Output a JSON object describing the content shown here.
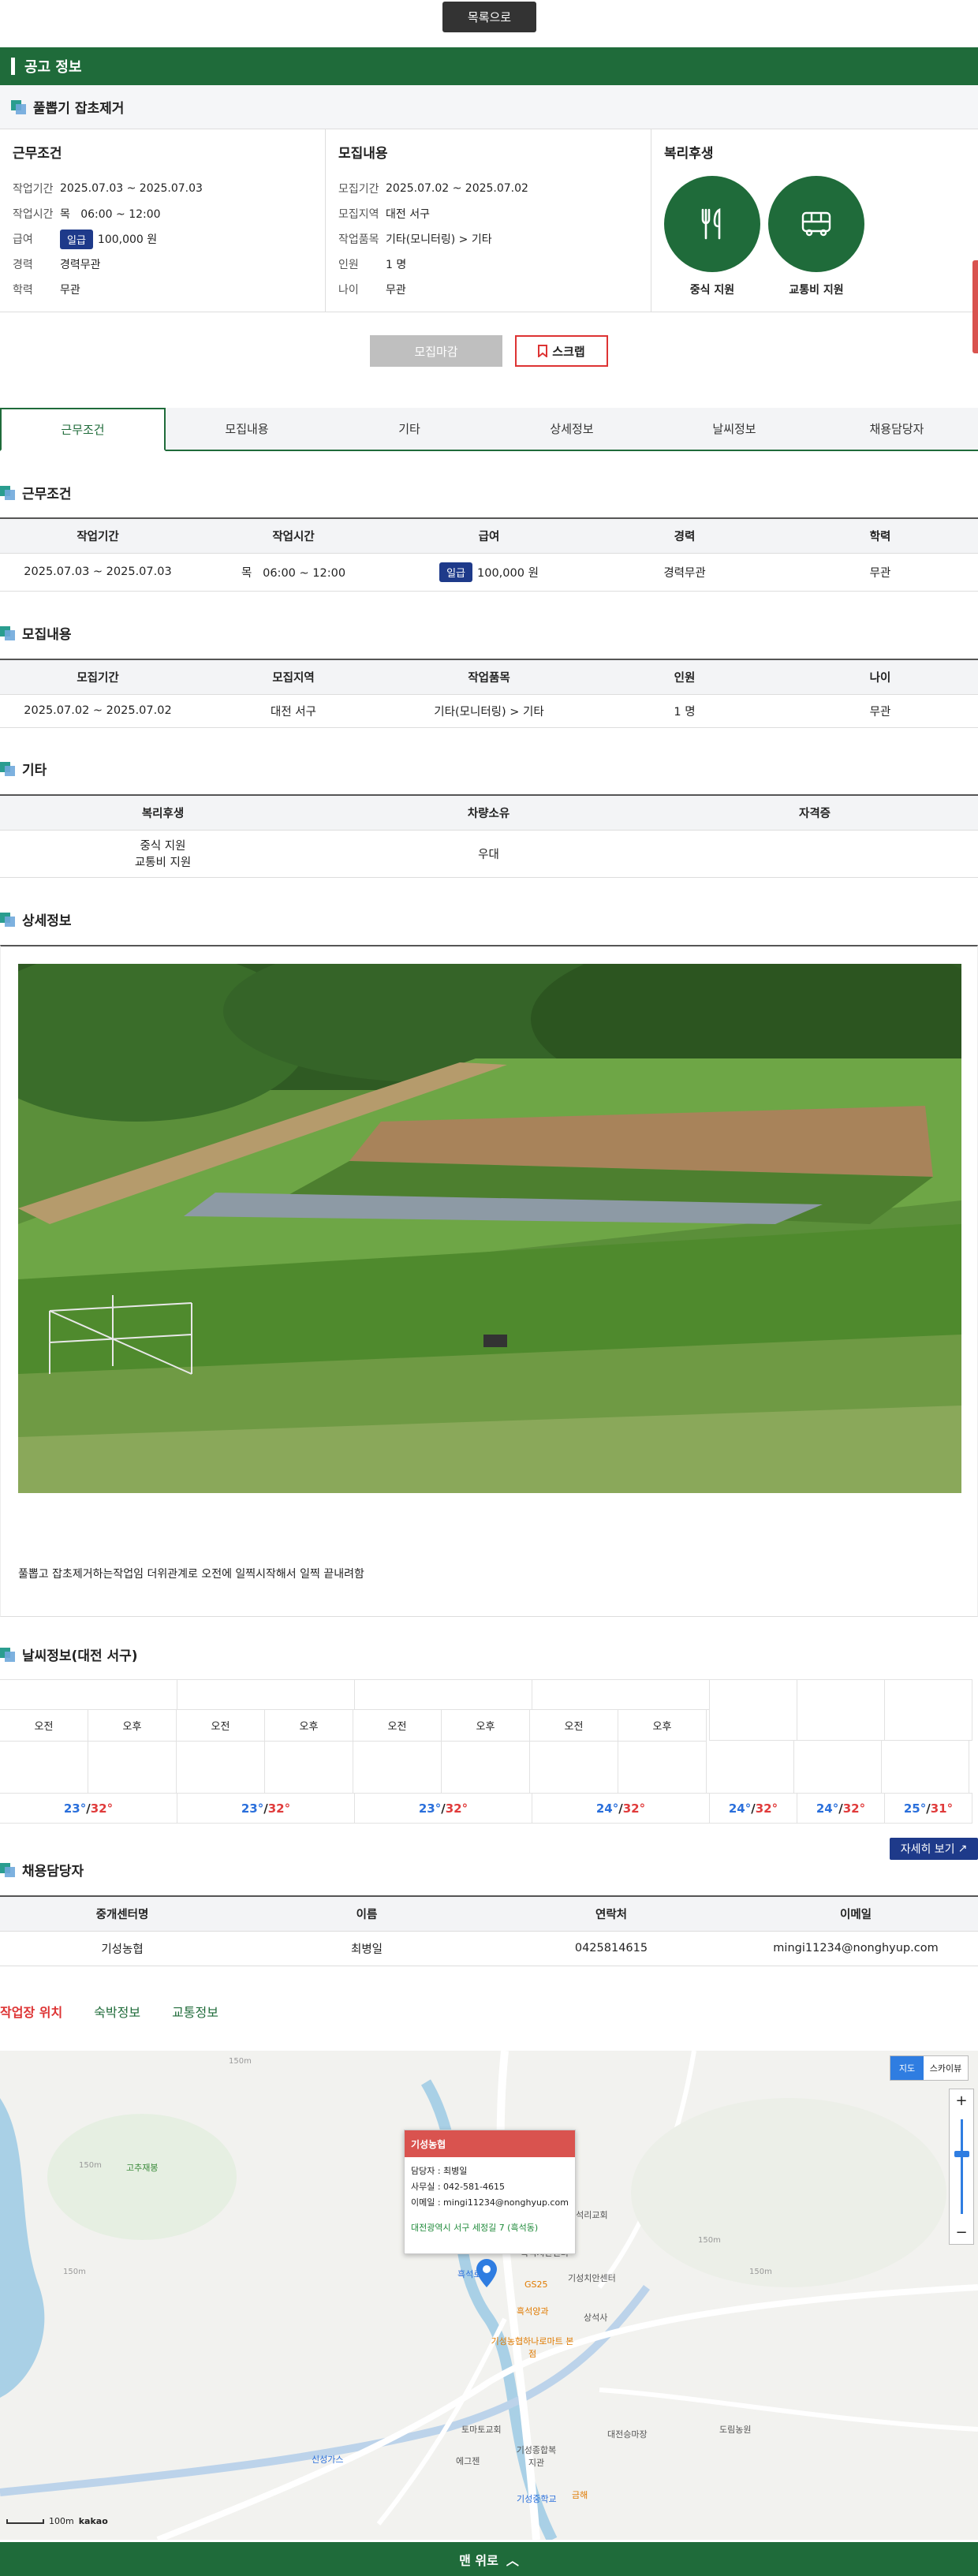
{
  "top": {
    "list_button": "목록으로"
  },
  "notice": {
    "title": "공고 정보"
  },
  "job": {
    "title": "풀뽑기 잡초제거"
  },
  "summary": {
    "work": {
      "heading": "근무조건",
      "rows": [
        {
          "k": "작업기간",
          "v": "2025.07.03 ~ 2025.07.03"
        },
        {
          "k": "작업시간",
          "v": "목   06:00 ~ 12:00"
        },
        {
          "k": "급여",
          "badge": "일급",
          "v": "100,000 원"
        },
        {
          "k": "경력",
          "v": "경력무관"
        },
        {
          "k": "학력",
          "v": "무관"
        }
      ]
    },
    "recruit": {
      "heading": "모집내용",
      "rows": [
        {
          "k": "모집기간",
          "v": "2025.07.02 ~ 2025.07.02"
        },
        {
          "k": "모집지역",
          "v": "대전 서구"
        },
        {
          "k": "작업품목",
          "v": "기타(모니터링) > 기타"
        },
        {
          "k": "인원",
          "v": "1 명"
        },
        {
          "k": "나이",
          "v": "무관"
        }
      ]
    },
    "welfare": {
      "heading": "복리후생",
      "items": [
        {
          "label": "중식 지원",
          "icon": "utensils-icon"
        },
        {
          "label": "교통비 지원",
          "icon": "bus-icon"
        }
      ]
    }
  },
  "actions": {
    "closed": "모집마감",
    "scrap": "스크랩"
  },
  "tabs": [
    "근무조건",
    "모집내용",
    "기타",
    "상세정보",
    "날씨정보",
    "채용담당자"
  ],
  "sections": {
    "work": {
      "title": "근무조건",
      "headers": [
        "작업기간",
        "작업시간",
        "급여",
        "경력",
        "학력"
      ],
      "row": {
        "period": "2025.07.03 ~ 2025.07.03",
        "day": "목",
        "time": "06:00 ~ 12:00",
        "pay_badge": "일급",
        "pay": "100,000 원",
        "career": "경력무관",
        "edu": "무관"
      }
    },
    "recruit": {
      "title": "모집내용",
      "headers": [
        "모집기간",
        "모집지역",
        "작업품목",
        "인원",
        "나이"
      ],
      "row": [
        "2025.07.02 ~ 2025.07.02",
        "대전 서구",
        "기타(모니터링) > 기타",
        "1 명",
        "무관"
      ]
    },
    "etc": {
      "title": "기타",
      "headers": [
        "복리후생",
        "차량소유",
        "자격증"
      ],
      "welfare1": "중식 지원",
      "welfare2": "교통비 지원",
      "vehicle": "우대",
      "license": ""
    },
    "detail": {
      "title": "상세정보",
      "text": "풀뽑고 잡초제거하는작업임 더위관계로 오전에 일찍시작해서 일찍 끝내려함"
    },
    "weather": {
      "title": "날씨정보(대전 서구)",
      "am": "오전",
      "pm": "오후",
      "temps": [
        {
          "lo": "23°",
          "hi": "32°"
        },
        {
          "lo": "23°",
          "hi": "32°"
        },
        {
          "lo": "23°",
          "hi": "32°"
        },
        {
          "lo": "24°",
          "hi": "32°"
        },
        {
          "lo": "24°",
          "hi": "32°"
        },
        {
          "lo": "24°",
          "hi": "32°"
        },
        {
          "lo": "25°",
          "hi": "31°"
        }
      ],
      "more": "자세히 보기"
    },
    "contact": {
      "title": "채용담당자",
      "headers": [
        "중개센터명",
        "이름",
        "연락처",
        "이메일"
      ],
      "row": [
        "기성농협",
        "최병일",
        "0425814615",
        "mingi11234@nonghyup.com"
      ]
    }
  },
  "location_tabs": [
    "작업장 위치",
    "숙박정보",
    "교통정보"
  ],
  "map": {
    "popup_title": "기성농협",
    "popup_lines": [
      "담당자 : 최병일",
      "사무실 : 042-581-4615",
      "이메일 : mingi11234@nonghyup.com"
    ],
    "popup_address": "대전광역시 서구 세정길 7 (흑석동)",
    "type_map": "지도",
    "type_sky": "스카이뷰",
    "scale": "100m",
    "brand": "kakao",
    "labels": [
      "고추재봉",
      "150m",
      "150m",
      "150m",
      "150m",
      "150m",
      "흑석리교회",
      "흑석치안센터",
      "기성치안센터",
      "GS25",
      "흑석로",
      "흑석양과",
      "상석사",
      "기성농협하나로마트 본점",
      "대전승마장",
      "도림농원",
      "토마토교회",
      "에그젠",
      "기성종합복지관",
      "신성가스",
      "기성중학교",
      "금해"
    ]
  },
  "bottom": {
    "label": "맨 위로"
  },
  "colors": {
    "brand_green": "#1f6b3a",
    "badge_navy": "#1e3a8a",
    "temp_low": "#2a6fdb",
    "temp_high": "#e03b3b",
    "accent_red": "#d33333"
  }
}
